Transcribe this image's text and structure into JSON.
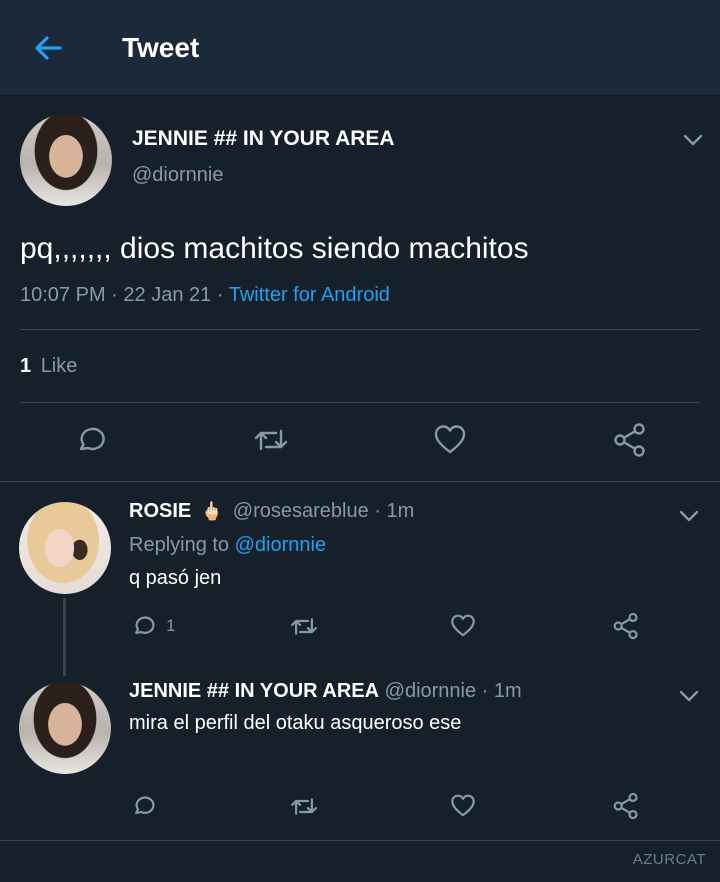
{
  "header": {
    "title": "Tweet"
  },
  "main_tweet": {
    "display_name": "JENNIE ## IN YOUR AREA",
    "handle": "@diornnie",
    "text": "pq,,,,,,, dios machitos siendo machitos",
    "time": "10:07 PM",
    "sep1": "·",
    "date": "22 Jan 21",
    "sep2": "·",
    "source": "Twitter for Android",
    "likes_count": "1",
    "likes_label": "Like"
  },
  "reply1": {
    "display_name": "ROSIE",
    "emoji": "🖕🏻",
    "handle": "@rosesareblue",
    "sep": "·",
    "age": "1m",
    "replying_label": "Replying to",
    "replying_handle": "@diornnie",
    "text": "q pasó jen",
    "reply_count": "1"
  },
  "reply2": {
    "display_name": "JENNIE ## IN YOUR AREA",
    "handle": "@diornnie",
    "sep": "·",
    "age": "1m",
    "text": "mira el perfil del otaku asqueroso ese"
  },
  "watermark": "AZURCAT",
  "icons": {
    "back": "arrow-left-icon",
    "chevron": "chevron-down-icon",
    "reply": "reply-icon",
    "retweet": "retweet-icon",
    "like": "heart-icon",
    "share": "share-icon"
  },
  "colors": {
    "background": "#15202b",
    "header": "#1c2938",
    "accent": "#1da1f2",
    "muted": "#8899a6",
    "divider": "#38444d"
  }
}
